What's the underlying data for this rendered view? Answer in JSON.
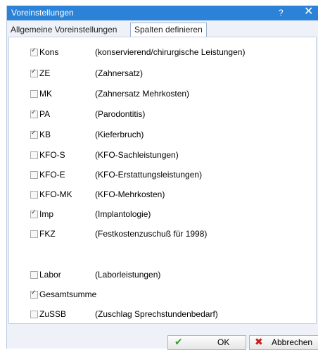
{
  "window": {
    "title": "Voreinstellungen",
    "help": "?",
    "close": "✕"
  },
  "tabs": [
    {
      "label": "Allgemeine Voreinstellungen"
    },
    {
      "label": "Spalten definieren"
    }
  ],
  "rows": [
    {
      "code": "Kons",
      "desc": "(konservierend/chirurgische Leistungen)",
      "checked": true
    },
    {
      "code": "ZE",
      "desc": "(Zahnersatz)",
      "checked": true
    },
    {
      "code": "MK",
      "desc": "(Zahnersatz Mehrkosten)",
      "checked": false
    },
    {
      "code": "PA",
      "desc": "(Parodontitis)",
      "checked": true
    },
    {
      "code": "KB",
      "desc": "(Kieferbruch)",
      "checked": true
    },
    {
      "code": "KFO-S",
      "desc": "(KFO-Sachleistungen)",
      "checked": false
    },
    {
      "code": "KFO-E",
      "desc": "(KFO-Erstattungsleistungen)",
      "checked": false
    },
    {
      "code": "KFO-MK",
      "desc": "(KFO-Mehrkosten)",
      "checked": false
    },
    {
      "code": "Imp",
      "desc": "(Implantologie)",
      "checked": true
    },
    {
      "code": "FKZ",
      "desc": "(Festkostenzuschuß für 1998)",
      "checked": false
    },
    {
      "code": "Labor",
      "desc": "(Laborleistungen)",
      "checked": false
    },
    {
      "code": "Gesamtsumme",
      "desc": "",
      "checked": true
    },
    {
      "code": "ZuSSB",
      "desc": "(Zuschlag Sprechstundenbedarf)",
      "checked": false
    }
  ],
  "buttons": {
    "ok": "OK",
    "cancel": "Abbrechen"
  }
}
